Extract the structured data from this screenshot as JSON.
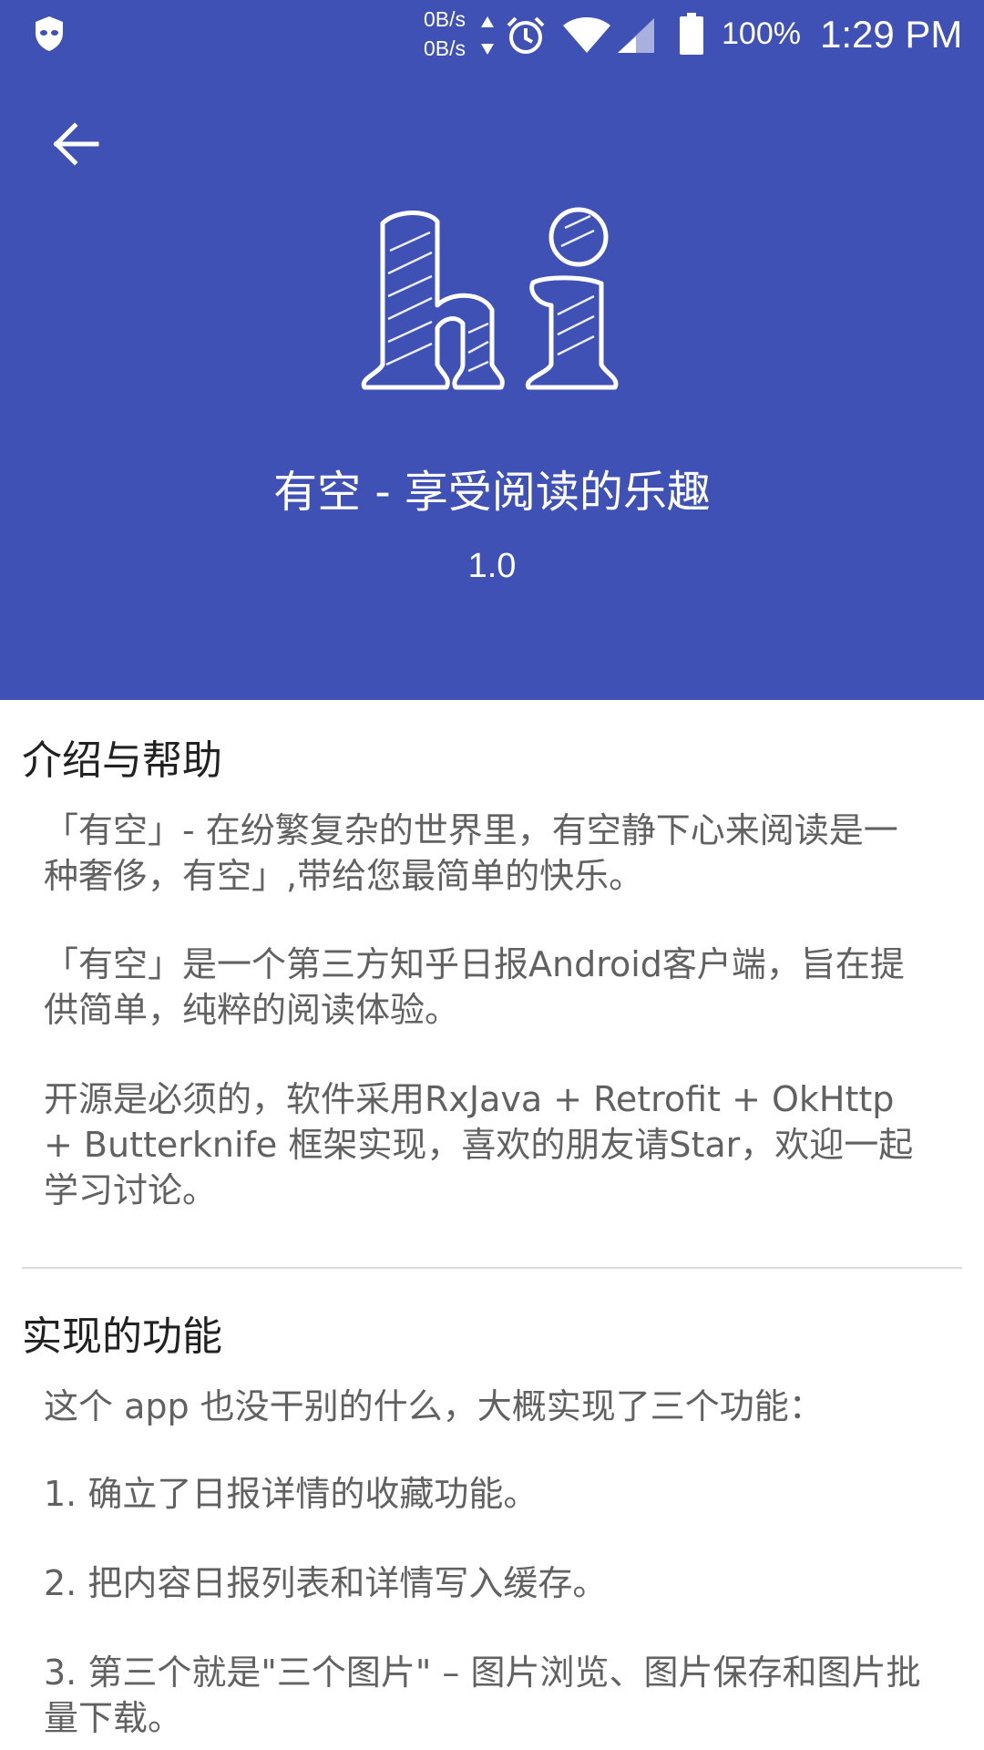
{
  "colors": {
    "primary": "#3f51b5",
    "status_text": "#ffffff"
  },
  "status_bar": {
    "net_up": "0B/s",
    "net_down": "0B/s",
    "battery": "100%",
    "time": "1:29 PM",
    "icons": [
      "incognito-icon",
      "alarm-icon",
      "wifi-icon",
      "signal-icon",
      "battery-icon"
    ]
  },
  "toolbar": {
    "back_icon": "arrow-left-icon"
  },
  "header": {
    "logo_text": "hi",
    "app_title": "有空 - 享受阅读的乐趣",
    "version": "1.0"
  },
  "sections": [
    {
      "title": "介绍与帮助",
      "paragraphs": [
        "「有空」- 在纷繁复杂的世界里，有空静下心来阅读是一种奢侈，有空」,带给您最简单的快乐。",
        "「有空」是一个第三方知乎日报Android客户端，旨在提供简单，纯粹的阅读体验。",
        "开源是必须的，软件采用RxJava + Retrofit + OkHttp + Butterknife 框架实现，喜欢的朋友请Star，欢迎一起学习讨论。"
      ]
    },
    {
      "title": "实现的功能",
      "paragraphs": [
        "这个 app 也没干别的什么，大概实现了三个功能：",
        " 1. 确立了日报详情的收藏功能。",
        " 2. 把内容日报列表和详情写入缓存。",
        " 3. 第三个就是\"三个图片\" – 图片浏览、图片保存和图片批量下载。"
      ]
    }
  ]
}
